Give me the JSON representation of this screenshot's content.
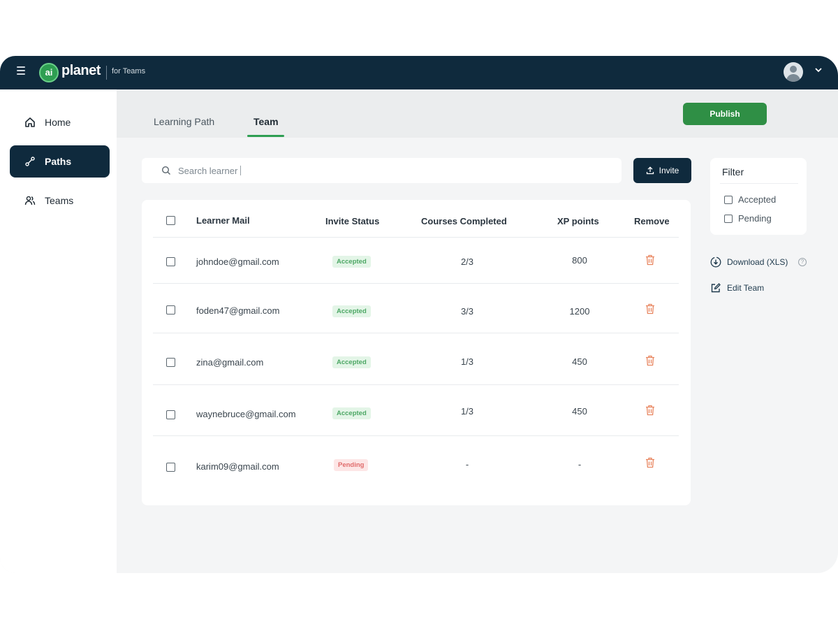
{
  "header": {
    "logo_mark": "ai",
    "logo_text": "planet",
    "subtitle": "for Teams"
  },
  "sidebar": {
    "items": [
      {
        "label": "Home",
        "icon": "home-icon",
        "active": false
      },
      {
        "label": "Paths",
        "icon": "path-icon",
        "active": true
      },
      {
        "label": "Teams",
        "icon": "teams-icon",
        "active": false
      }
    ]
  },
  "tabs": [
    {
      "label": "Learning Path",
      "active": false
    },
    {
      "label": "Team",
      "active": true
    }
  ],
  "publish_label": "Publish",
  "search": {
    "placeholder": "Search learner"
  },
  "invite_label": "Invite",
  "table": {
    "headers": {
      "mail": "Learner Mail",
      "status": "Invite Status",
      "courses": "Courses Completed",
      "xp": "XP points",
      "remove": "Remove"
    },
    "rows": [
      {
        "mail": "johndoe@gmail.com",
        "status": "Accepted",
        "courses": "2/3",
        "xp": "800"
      },
      {
        "mail": "foden47@gmail.com",
        "status": "Accepted",
        "courses": "3/3",
        "xp": "1200"
      },
      {
        "mail": "zina@gmail.com",
        "status": "Accepted",
        "courses": "1/3",
        "xp": "450"
      },
      {
        "mail": "waynebruce@gmail.com",
        "status": "Accepted",
        "courses": "1/3",
        "xp": "450"
      },
      {
        "mail": "karim09@gmail.com",
        "status": "Pending",
        "courses": "-",
        "xp": "-"
      }
    ]
  },
  "filter": {
    "title": "Filter",
    "options": [
      "Accepted",
      "Pending"
    ]
  },
  "actions": {
    "download": "Download (XLS)",
    "help": "?",
    "edit_team": "Edit Team"
  },
  "colors": {
    "navy": "#0f2a3d",
    "green": "#2f8f45",
    "accepted_bg": "#e3f5e7",
    "pending_bg": "#fde6e6",
    "trash": "#e8855f"
  }
}
